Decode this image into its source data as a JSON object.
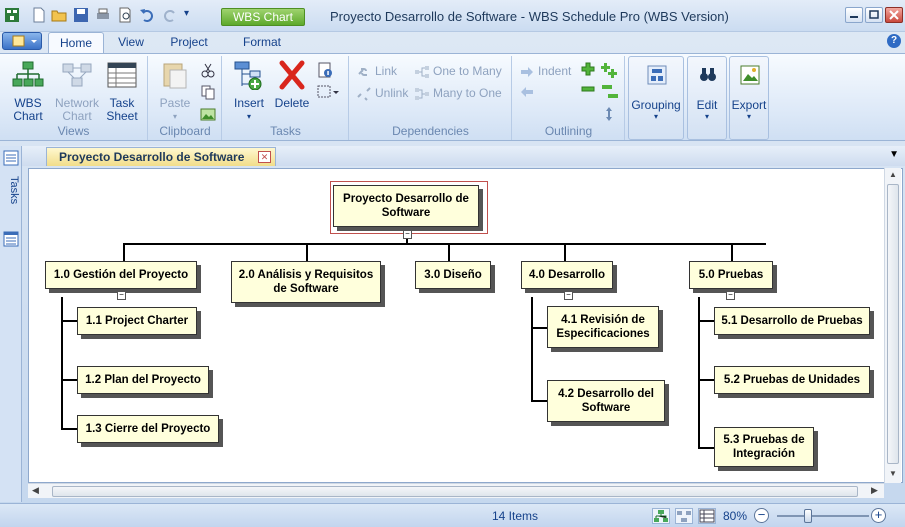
{
  "window": {
    "title": "Proyecto Desarrollo de Software - WBS Schedule Pro (WBS Version)",
    "contextual_tab": "WBS Chart"
  },
  "ribbon": {
    "tabs": [
      "Home",
      "View",
      "Project",
      "Format"
    ],
    "active_tab": "Home",
    "groups": {
      "views": {
        "label": "Views",
        "wbs_chart": "WBS\nChart",
        "network_chart": "Network\nChart",
        "task_sheet": "Task\nSheet"
      },
      "clipboard": {
        "label": "Clipboard",
        "paste": "Paste"
      },
      "tasks": {
        "label": "Tasks",
        "insert": "Insert",
        "delete": "Delete"
      },
      "dependencies": {
        "label": "Dependencies",
        "link": "Link",
        "unlink": "Unlink",
        "one_to_many": "One to Many",
        "many_to_one": "Many to One"
      },
      "outlining": {
        "label": "Outlining",
        "indent": "Indent"
      },
      "grouping": "Grouping",
      "edit": "Edit",
      "export": "Export"
    }
  },
  "sidebar": {
    "tasks_label": "Tasks"
  },
  "document_tab": {
    "title": "Proyecto Desarrollo de Software"
  },
  "wbs": {
    "root": "Proyecto Desarrollo de Software",
    "nodes": {
      "n1": "1.0 Gestión del Proyecto",
      "n11": "1.1 Project Charter",
      "n12": "1.2 Plan del Proyecto",
      "n13": "1.3 Cierre del Proyecto",
      "n2": "2.0 Análisis y Requisitos de Software",
      "n3": "3.0 Diseño",
      "n4": "4.0 Desarrollo",
      "n41": "4.1 Revisión de Especificaciones",
      "n42": "4.2 Desarrollo del Software",
      "n5": "5.0 Pruebas",
      "n51": "5.1 Desarrollo de Pruebas",
      "n52": "5.2 Pruebas de Unidades",
      "n53": "5.3 Pruebas de Integración"
    }
  },
  "status": {
    "items": "14 Items",
    "zoom": "80%"
  }
}
